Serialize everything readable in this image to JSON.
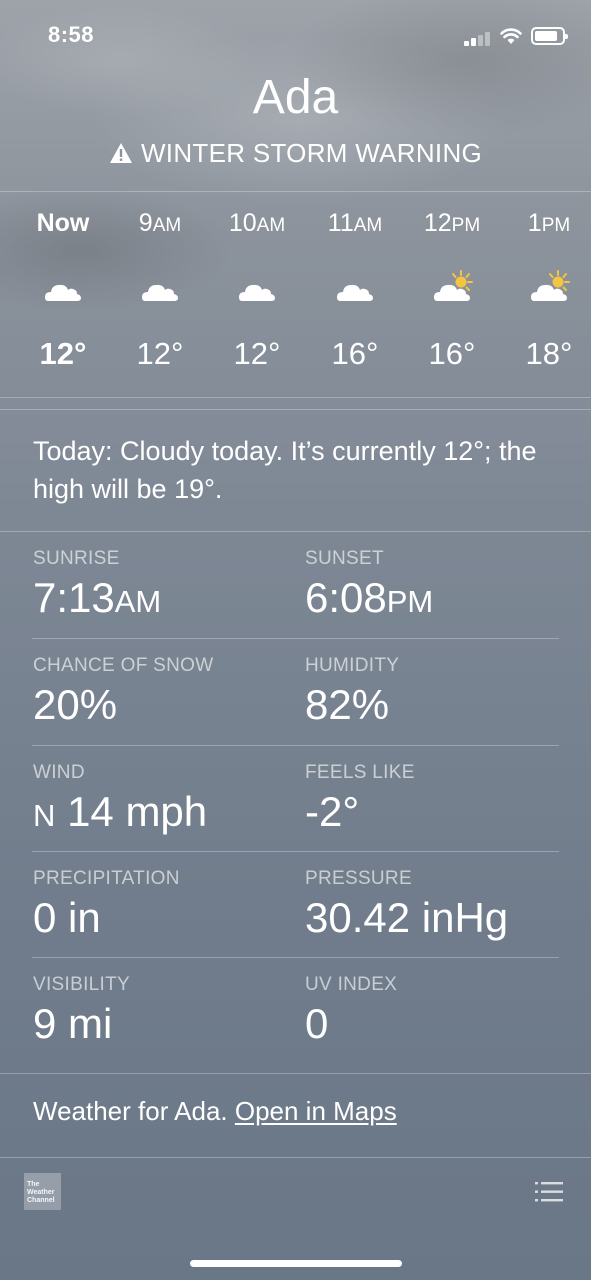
{
  "status_bar": {
    "time": "8:58"
  },
  "location": {
    "city": "Ada",
    "warning": "WINTER STORM WARNING"
  },
  "hourly": [
    {
      "label": "Now",
      "icon": "cloud-icon",
      "temp": "12°"
    },
    {
      "label": "9",
      "suffix": "AM",
      "icon": "cloud-icon",
      "temp": "12°"
    },
    {
      "label": "10",
      "suffix": "AM",
      "icon": "cloud-icon",
      "temp": "12°"
    },
    {
      "label": "11",
      "suffix": "AM",
      "icon": "cloud-icon",
      "temp": "16°"
    },
    {
      "label": "12",
      "suffix": "PM",
      "icon": "partly-sunny-icon",
      "temp": "16°"
    },
    {
      "label": "1",
      "suffix": "PM",
      "icon": "partly-sunny-icon",
      "temp": "18°"
    }
  ],
  "summary": "Today: Cloudy today. It’s currently 12°; the high will be 19°.",
  "details": {
    "sunrise": {
      "label": "SUNRISE",
      "value": "7:13",
      "suffix": "AM"
    },
    "sunset": {
      "label": "SUNSET",
      "value": "6:08",
      "suffix": "PM"
    },
    "snow": {
      "label": "CHANCE OF SNOW",
      "value": "20%"
    },
    "humidity": {
      "label": "HUMIDITY",
      "value": "82%"
    },
    "wind": {
      "label": "WIND",
      "dir": "N",
      "value": "14 mph"
    },
    "feels_like": {
      "label": "FEELS LIKE",
      "value": "-2°"
    },
    "precipitation": {
      "label": "PRECIPITATION",
      "value": "0 in"
    },
    "pressure": {
      "label": "PRESSURE",
      "value": "30.42 inHg"
    },
    "visibility": {
      "label": "VISIBILITY",
      "value": "9 mi"
    },
    "uv": {
      "label": "UV INDEX",
      "value": "0"
    }
  },
  "footer": {
    "prefix": "Weather for Ada. ",
    "link": "Open in Maps",
    "logo_line1": "The",
    "logo_line2": "Weather",
    "logo_line3": "Channel"
  },
  "colors": {
    "sun": "#f5c542",
    "text": "#ffffff"
  }
}
